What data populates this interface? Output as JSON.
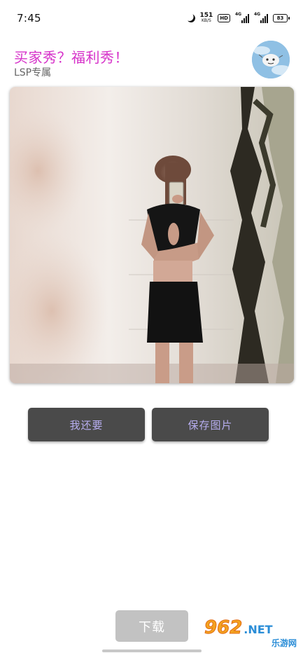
{
  "status_bar": {
    "time": "7:45",
    "net_speed_value": "151",
    "net_speed_unit": "KB/S",
    "hd_label": "HD",
    "signal_1_label": "4G",
    "signal_2_label": "4G",
    "battery_level": "83"
  },
  "header": {
    "title": "买家秀？福利秀！",
    "subtitle": "LSP专属"
  },
  "actions": {
    "more_label": "我还要",
    "save_label": "保存图片"
  },
  "download": {
    "label": "下载"
  },
  "watermark": {
    "digits": "962",
    "net": ".NET",
    "cn": "乐游网"
  },
  "colors": {
    "title": "#d631c9",
    "button_bg": "#4a4a4a",
    "button_text": "#b7aef0",
    "download_bg": "#c2c2c2"
  }
}
